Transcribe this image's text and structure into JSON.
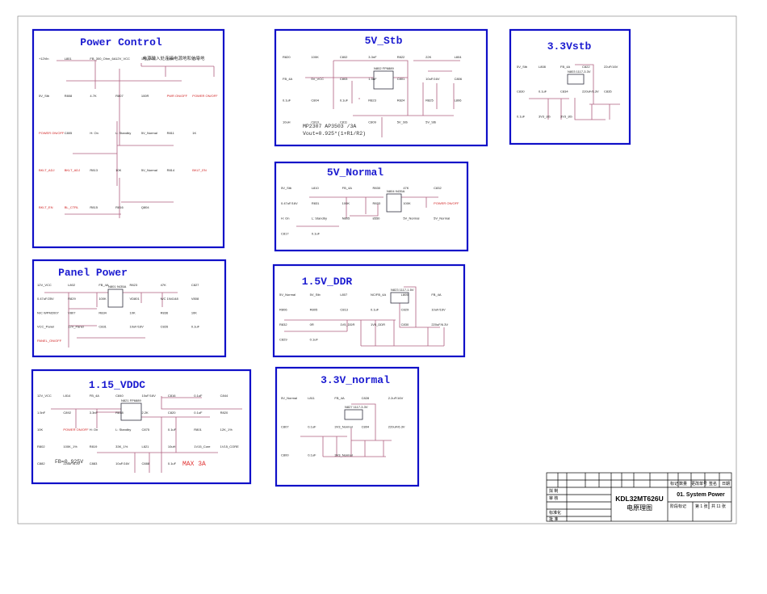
{
  "blocks": {
    "power_control": {
      "title": "Power Control",
      "note": "电源输入处连接电源地和信号地",
      "labels": [
        "+12Vin",
        "L801",
        "FB_300_Ohm_6A",
        "12V_VCC",
        "12V_VCC",
        "C800",
        "0.1uF",
        "5V_Stb",
        "R808",
        "4.7K",
        "R807",
        "100R",
        "PWR ON/OFF",
        "POWER ON/OFF",
        "POWER ON/OFF",
        "C805",
        "H: On",
        "L: Standby",
        "5V_Normal",
        "R811",
        "1K",
        "BKLT_ADJ",
        "BKLT_ADJ",
        "R813",
        "10K",
        "5V_Normal",
        "R814",
        "BKLT_EN",
        "BKLT_EN",
        "BL_CTRL",
        "R815",
        "R816",
        "Q804"
      ]
    },
    "five_v_stb": {
      "title": "5V_Stb",
      "chip": "N802 FP6889",
      "labels": [
        "R820",
        "100K",
        "C802",
        "3.3nF",
        "R822",
        "22K",
        "L804",
        "FB_4A",
        "5V_VCC",
        "C803",
        "1.5nF",
        "C801",
        "10uF/16V",
        "C806",
        "0.1uF",
        "C804",
        "0.1uF",
        "R823",
        "R824",
        "R825",
        "L806",
        "10uH",
        "C810",
        "C811",
        "C809",
        "5V_Stb",
        "5V_Stb"
      ],
      "note1": "MP2307 AP3503 /3A",
      "note2": "Vout=0.925*(1+R1/R2)"
    },
    "three_v3_stb": {
      "title": "3.3Vstb",
      "chip": "N803 1117-3.3V",
      "labels": [
        "5V_Stb",
        "L808",
        "FB_4A",
        "C822",
        "22uF/16V",
        "C830",
        "0.1uF",
        "C834",
        "220uF/6.3V",
        "C835",
        "0.1uF",
        "3V3_stb",
        "3V3_stb"
      ]
    },
    "five_v_normal": {
      "title": "5V_Normal",
      "chip": "N804 9435A",
      "labels": [
        "5V_Stb",
        "L810",
        "FB_4A",
        "R830",
        "47K",
        "C832",
        "0.47uF/16V",
        "R831",
        "100K",
        "R833",
        "100K",
        "POWER ON/OFF",
        "H: On",
        "L: Standby",
        "N805",
        "8550",
        "5V_Normal",
        "5V_Normal",
        "C817",
        "0.1uF"
      ]
    },
    "panel_power": {
      "title": "Panel Power",
      "chip": "N801 9435A",
      "labels": [
        "12V_VCC",
        "L802",
        "FB_4A",
        "R823",
        "47K",
        "C827",
        "0.47uF/25V",
        "R829",
        "100K",
        "VD801",
        "N/C 1N4148",
        "V808",
        "N/C WPM2007",
        "V807",
        "R834",
        "10K",
        "R836",
        "10K",
        "VCC_Panel",
        "12V_Panel",
        "C831",
        "10uF/16V",
        "C826",
        "0.1uF",
        "PANEL_ON/OFF"
      ]
    },
    "one_v5_ddr": {
      "title": "1.5V_DDR",
      "chip": "N823 1117-1.5V",
      "labels": [
        "5V_Normal",
        "5V_Stb",
        "L807",
        "NC/FB_4A",
        "L805",
        "FB_4A",
        "R806",
        "R805",
        "C813",
        "0.1uF",
        "C829",
        "10uF/16V",
        "R832",
        "0R",
        "1V5_DDR",
        "1V5_DDR",
        "C830",
        "220uF/6.3V",
        "C829",
        "0.1uF"
      ]
    },
    "one_v15_vddc": {
      "title": "1.15_VDDC",
      "chip": "N821 FP6889",
      "labels": [
        "12V_VCC",
        "L814",
        "FB_4A",
        "C840",
        "10uF/16V",
        "C816",
        "0.1uF",
        "C844",
        "1.5nF",
        "C892",
        "3.3nF",
        "R818",
        "2.2K",
        "C820",
        "0.1uF",
        "R820",
        "10K",
        "POWER ON/OFF",
        "H: On",
        "L: Standby",
        "C875",
        "0.1uF",
        "R801",
        "12K_1%",
        "R802",
        "100K_1%",
        "R819",
        "33K_1%",
        "L821",
        "10uH",
        "1V15_Core",
        "1V15_CORE",
        "C882",
        "220uF/6.3V",
        "C883",
        "10uF/16V",
        "C888",
        "0.1uF"
      ],
      "note": "FB=0.925V",
      "max": "MAX 3A"
    },
    "three_v3_normal": {
      "title": "3.3V_normal",
      "chip": "N827 1117-3.3V",
      "labels": [
        "5V_Normal",
        "L811",
        "FB_4A",
        "C828",
        "2.2uF/16V",
        "C807",
        "0.1uF",
        "3V3_Normal",
        "C804",
        "220uF/6.3V",
        "C800",
        "0.1uF",
        "3V3_Normal"
      ]
    }
  },
  "title_block": {
    "header": [
      "标记",
      "数量",
      "更改单号",
      "签名",
      "日期"
    ],
    "left_rows": [
      "拟 制",
      "审 核",
      "",
      "",
      "标准化",
      "批 准"
    ],
    "model": "KDL32MT626U",
    "doc_type": "电原理图",
    "sheet_title": "01. System Power",
    "stage": "阶段标记",
    "sheet": "第 1 张",
    "total": "共 11 张"
  },
  "colors": {
    "block_border": "#1010c8",
    "title": "#1a1ad0",
    "wire": "#b06080",
    "net_label": "#d02020"
  }
}
